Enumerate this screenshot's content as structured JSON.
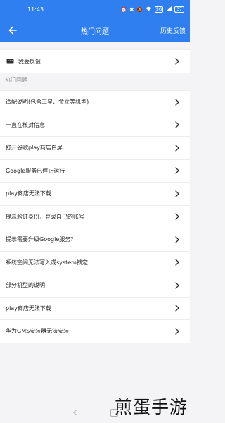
{
  "status_bar": {
    "time": "11:43",
    "icons": [
      "alarm-icon",
      "bluetooth-icon",
      "mute-icon",
      "wifi-icon",
      "signal-icon",
      "signal-icon"
    ],
    "hd_badge": "5G",
    "battery": "37"
  },
  "app_bar": {
    "title": "热门问题",
    "history_label": "历史反馈"
  },
  "feedback": {
    "label": "我要反馈"
  },
  "section": {
    "header": "热门问题"
  },
  "faq_items": [
    "适配说明(包含三星、金立等机型)",
    "一直在核对信息",
    "打开谷歌play商店白屏",
    "Google服务已停止运行",
    "play商店无法下载",
    "提示验证身份，登录自己的账号",
    "提示需要升级Google服务？",
    "系统空间无法写入或system锁定",
    "部分机型的说明",
    "play商店无法下载",
    "华为GMS安装器无法安装"
  ],
  "watermark": "煎蛋手游",
  "colors": {
    "accent": "#2f7ff0",
    "background": "#f4f4f6"
  }
}
